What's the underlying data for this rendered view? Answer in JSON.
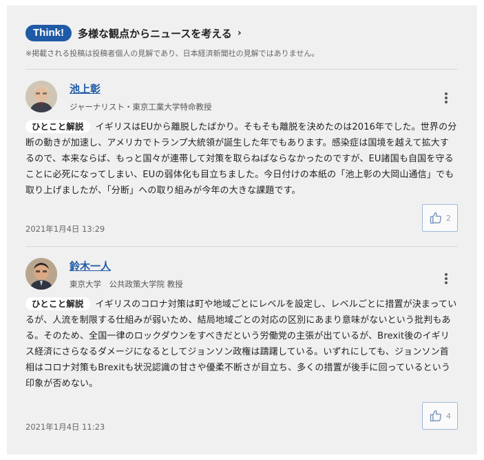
{
  "header": {
    "badge": "Think!",
    "title": "多様な観点からニュースを考える",
    "chevron": "›",
    "disclaimer": "※掲載される投稿は投稿者個人の見解であり、日本経済新聞社の見解ではありません。"
  },
  "comments": [
    {
      "author": "池上彰",
      "title": "ジャーナリスト・東京工業大学特命教授",
      "tag": "ひとこと解説",
      "text": "イギリスはEUから離脱したばかり。そもそも離脱を決めたのは2016年でした。世界の分断の動きが加速し、アメリカでトランプ大統領が誕生した年でもあります。感染症は国境を越えて拡大するので、本来ならば、もっと国々が連帯して対策を取らねばならなかったのですが、EU諸国も自国を守ることに必死になってしまい、EUの弱体化も目立ちました。今日付けの本紙の「池上彰の大岡山通信」でも取り上げましたが、「分断」への取り組みが今年の大きな課題です。",
      "timestamp": "2021年1月4日 13:29",
      "likes": "2",
      "like_icon": "thumbs-up-icon",
      "menu_icon": "more-vertical-icon"
    },
    {
      "author": "鈴木一人",
      "title": "東京大学　公共政策大学院 教授",
      "tag": "ひとこと解説",
      "text": "イギリスのコロナ対策は町や地域ごとにレベルを設定し、レベルごとに措置が決まっているが、人流を制限する仕組みが弱いため、結局地域ごとの対応の区別にあまり意味がないという批判もある。そのため、全国一律のロックダウンをすべきだという労働党の主張が出ているが、Brexit後のイギリス経済にさらなるダメージになるとしてジョンソン政権は躊躇している。いずれにしても、ジョンソン首相はコロナ対策もBrexitも状況認識の甘さや優柔不断さが目立ち、多くの措置が後手に回っているという印象が否めない。",
      "timestamp": "2021年1月4日 11:23",
      "likes": "4",
      "like_icon": "thumbs-up-icon",
      "menu_icon": "more-vertical-icon"
    }
  ],
  "colors": {
    "accent": "#1f5aa6",
    "panel_bg": "#f0f0f0",
    "like_border": "#9fb9d8"
  }
}
